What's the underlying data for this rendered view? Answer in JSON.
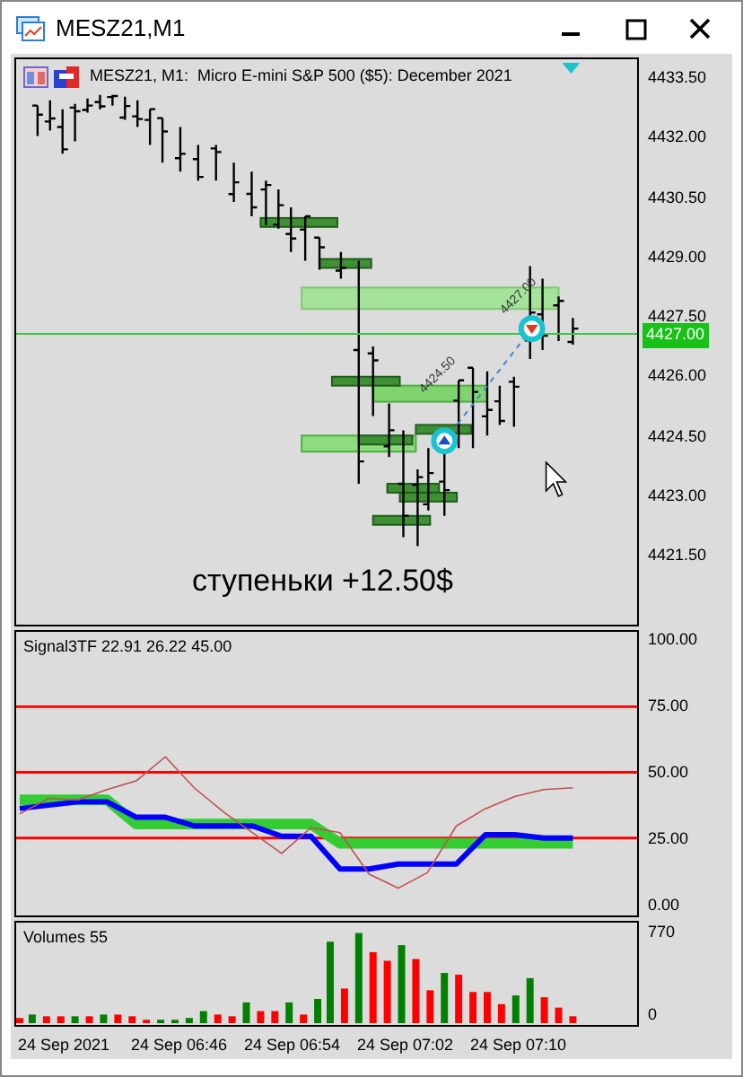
{
  "window": {
    "title": "MESZ21,M1"
  },
  "chart_header": "MESZ21, M1:  Micro E-mini S&P 500 ($5): December 2021",
  "price_axis": [
    "4433.50",
    "4432.00",
    "4430.50",
    "4429.00",
    "4427.50",
    "4426.00",
    "4424.50",
    "4423.00",
    "4421.50"
  ],
  "current_price": "4427.00",
  "trade_labels": [
    "4424.50",
    "4427.00"
  ],
  "annotation": "ступеньки +12.50$",
  "indicator": {
    "label": "Signal3TF 22.91 26.22 45.00",
    "chart_data": {
      "type": "line",
      "ylim": [
        -4.5,
        103.5
      ],
      "grid": true,
      "yticks": [
        {
          "value": 100,
          "label": "100.00"
        },
        {
          "value": 75,
          "label": "75.00"
        },
        {
          "value": 50,
          "label": "50.00"
        },
        {
          "value": 25,
          "label": "25.00"
        },
        {
          "value": 0,
          "label": "0.00"
        }
      ],
      "series": [
        {
          "color": "#33cc33",
          "values": [
            39.5,
            39.5,
            39.5,
            39.5,
            30.3,
            30.3,
            30.3,
            30.3,
            30.3,
            30.3,
            30.3,
            23,
            23,
            23,
            23,
            23,
            23,
            23,
            23,
            23
          ]
        },
        {
          "color": "#0000ff",
          "values": [
            36.2,
            37.5,
            38.8,
            38.8,
            32.9,
            32.9,
            29.6,
            29.6,
            29.6,
            25.7,
            25.7,
            13.2,
            13.2,
            15.1,
            15.1,
            15.1,
            26.3,
            26.3,
            25,
            25
          ]
        },
        {
          "color": "#c0504d",
          "values": [
            34.2,
            40.1,
            39.5,
            43.4,
            46.7,
            55.9,
            44,
            34.9,
            27,
            19.1,
            28.9,
            27,
            11.2,
            5.9,
            11.8,
            29.6,
            36.2,
            40.8,
            43.4,
            44.1
          ]
        }
      ]
    }
  },
  "volumes": {
    "label": "Volumes 55",
    "axis": [
      "770",
      "0"
    ]
  },
  "time_axis": [
    "24 Sep 2021",
    "24 Sep 06:46",
    "24 Sep 06:54",
    "24 Sep 07:02",
    "24 Sep 07:10"
  ]
}
